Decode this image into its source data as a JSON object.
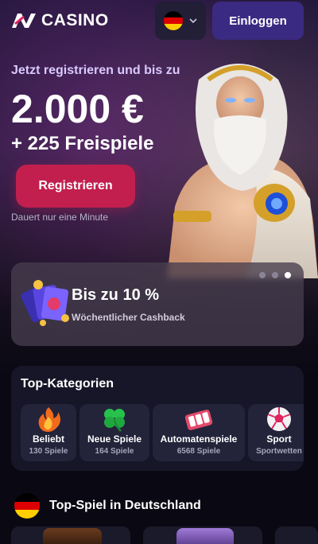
{
  "header": {
    "logo_text": "CASINO",
    "login_label": "Einloggen",
    "language_flag": "de-flag-icon"
  },
  "promo": {
    "subtitle": "Jetzt registrieren und bis zu",
    "amount": "2.000 €",
    "spins": "+ 225 Freispiele",
    "register_label": "Registrieren",
    "note": "Dauert nur eine Minute"
  },
  "cashback": {
    "title": "Bis zu 10 %",
    "subtitle": "Wöchentlicher Cashback",
    "slides": 3,
    "active_slide": 3
  },
  "categories": {
    "title": "Top-Kategorien",
    "items": [
      {
        "name": "Beliebt",
        "count": "130 Spiele",
        "icon": "flame-icon"
      },
      {
        "name": "Neue Spiele",
        "count": "164 Spiele",
        "icon": "clover-icon"
      },
      {
        "name": "Automatenspiele",
        "count": "6568 Spiele",
        "icon": "slot-reels-icon"
      },
      {
        "name": "Sport",
        "count": "Sportwetten",
        "icon": "soccer-ball-icon"
      }
    ]
  },
  "top_game": {
    "title": "Top-Spiel in Deutschland"
  },
  "colors": {
    "background": "#0a0913",
    "login_button": "#3b2a82",
    "register_button": "#c21f4e",
    "category_panel": "#161628",
    "category_item": "#23233a"
  }
}
